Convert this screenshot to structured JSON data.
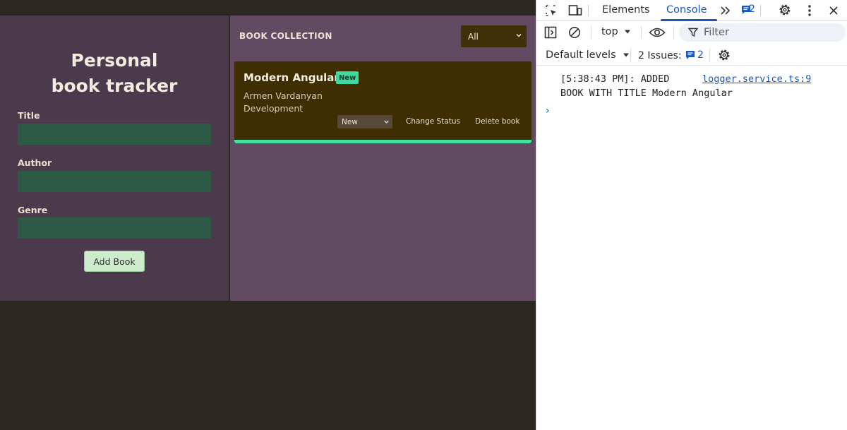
{
  "app": {
    "title": "Personal book tracker",
    "form": {
      "title_label": "Title",
      "title_value": "",
      "author_label": "Author",
      "author_value": "",
      "genre_label": "Genre",
      "genre_value": "",
      "add_button": "Add Book"
    },
    "collection": {
      "heading": "BOOK COLLECTION",
      "filter_selected": "All",
      "books": [
        {
          "title": "Modern Angular",
          "badge": "New",
          "author": "Armen Vardanyan",
          "genre": "Development",
          "status_selected": "New",
          "change_status_label": "Change Status",
          "delete_label": "Delete book"
        }
      ]
    },
    "colors": {
      "form_panel": "#4b3a4c",
      "collection_panel": "#624a62",
      "input_bg": "#2d5947",
      "card_bg": "#3f2e02",
      "accent": "#45e0a6"
    }
  },
  "devtools": {
    "tabs": [
      "Elements",
      "Console"
    ],
    "active_tab": "Console",
    "issues_badge": "2",
    "context": "top",
    "filter_placeholder": "Filter",
    "default_levels": "Default levels",
    "issues_label": "2 Issues:",
    "issues_count": "2",
    "log": {
      "line1": "[5:38:43 PM]: ADDED",
      "source": "logger.service.ts:9",
      "line2": "BOOK WITH TITLE Modern Angular"
    },
    "prompt": "›",
    "accent": "#1a56c4"
  }
}
